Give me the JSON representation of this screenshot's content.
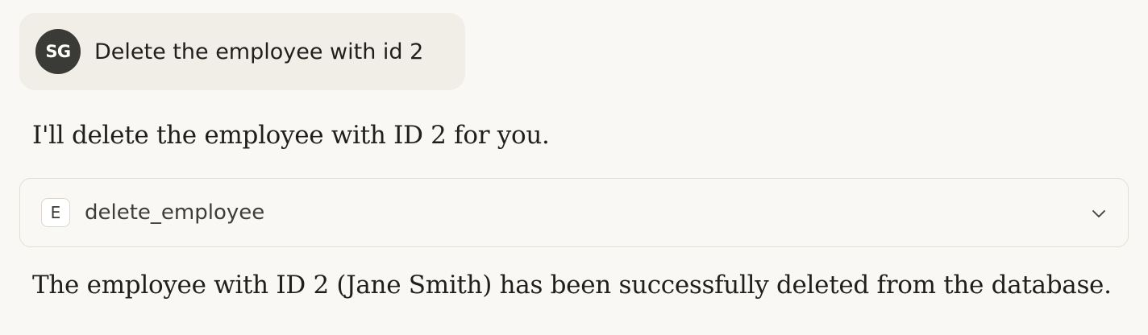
{
  "user_message": {
    "avatar_initials": "SG",
    "text": "Delete the employee with id 2"
  },
  "assistant": {
    "intro": "I'll delete the employee with ID 2 for you.",
    "tool_call": {
      "icon_letter": "E",
      "name": "delete_employee",
      "expand_icon": "chevron-down-icon"
    },
    "result": "The employee with ID 2 (Jane Smith) has been successfully deleted from the database."
  },
  "colors": {
    "background": "#f9f8f4",
    "user_bubble": "#f0eee7",
    "avatar": "#3a3a36",
    "text": "#1f1f1c",
    "border": "#e2dfd6"
  }
}
